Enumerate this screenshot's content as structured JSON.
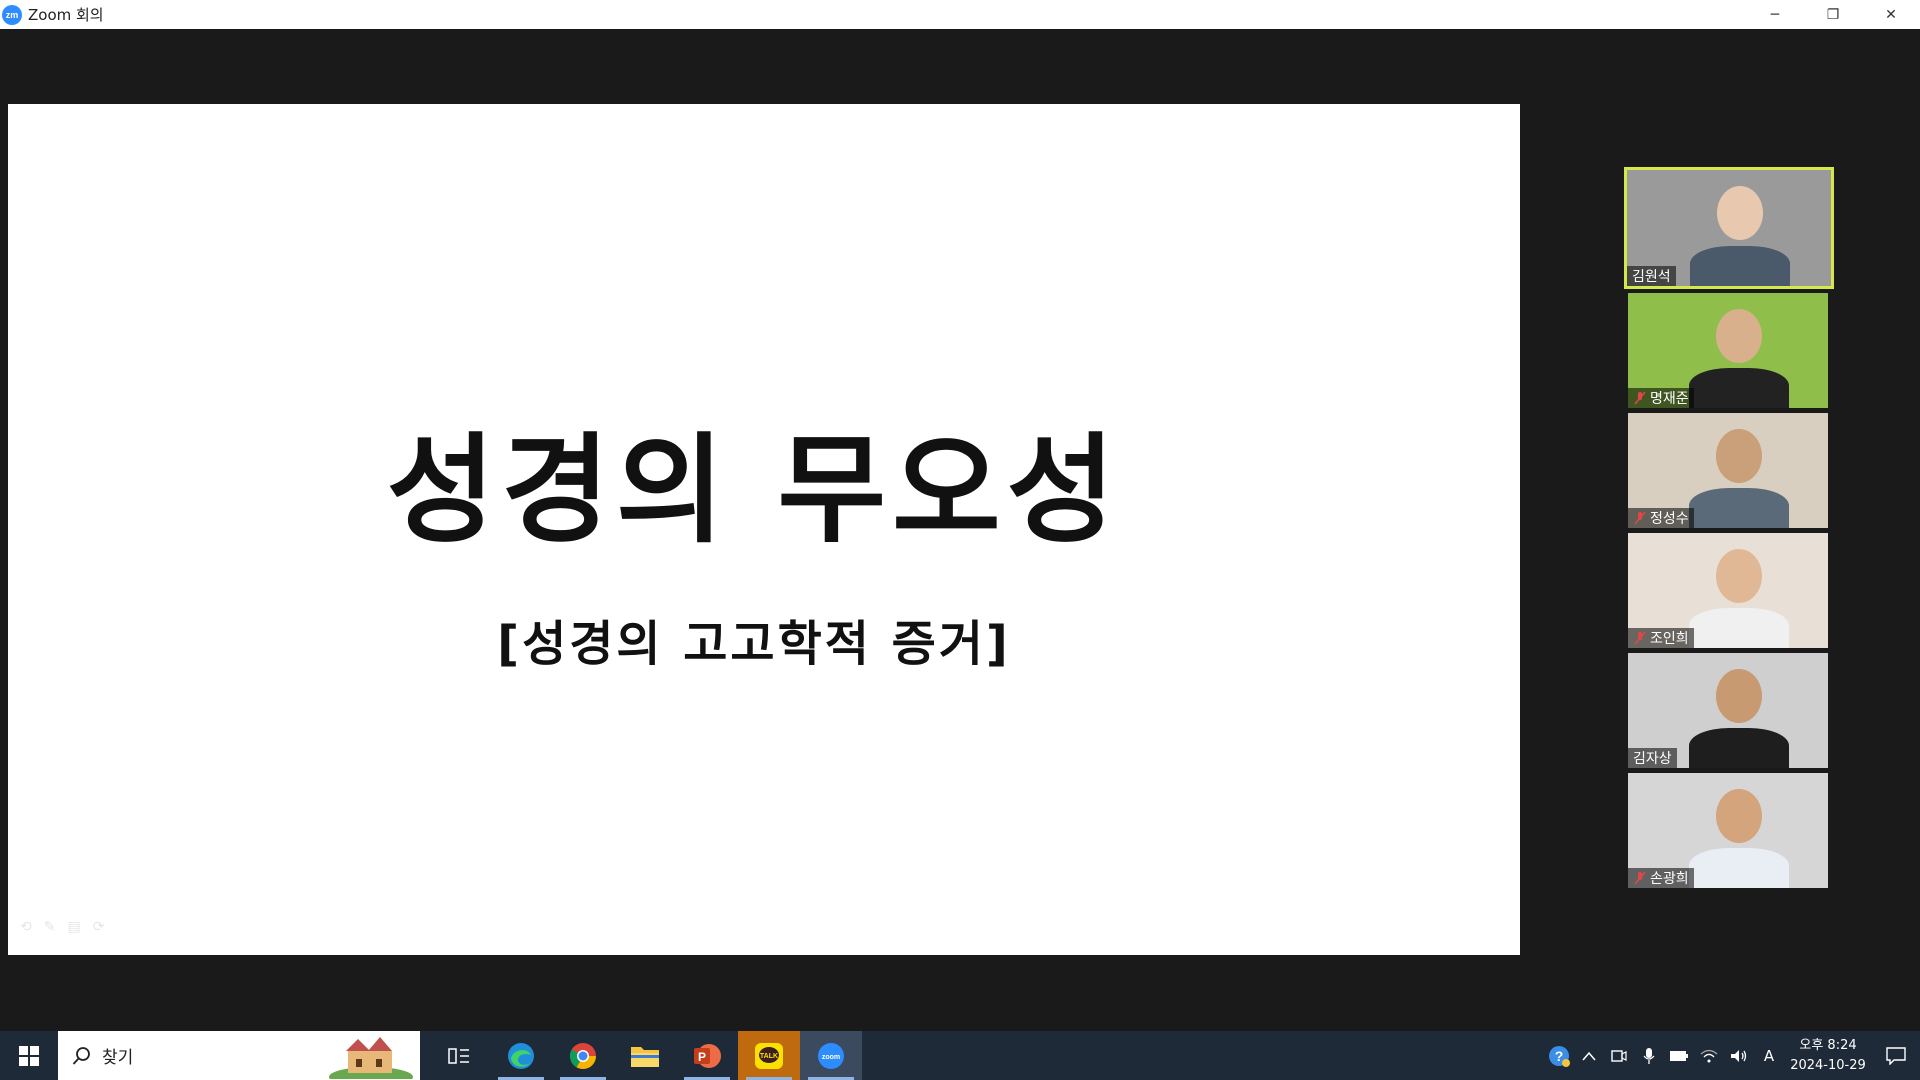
{
  "window": {
    "logo_text": "zm",
    "title": "Zoom 회의",
    "controls": {
      "minimize": "─",
      "restore": "❐",
      "close": "✕"
    }
  },
  "slide": {
    "title": "성경의 무오성",
    "subtitle": "[성경의 고고학적 증거]"
  },
  "participants": [
    {
      "name": "김원석",
      "muted": false,
      "active": true,
      "bg": "#9a9a9a",
      "skin": "#e8c9b0",
      "shirt": "#4a5a6a"
    },
    {
      "name": "명재준",
      "muted": true,
      "active": false,
      "bg": "#8fbf4a",
      "skin": "#d9b08c",
      "shirt": "#222222"
    },
    {
      "name": "정성수",
      "muted": true,
      "active": false,
      "bg": "#d8cfc0",
      "skin": "#c9a07a",
      "shirt": "#5a6a78"
    },
    {
      "name": "조인희",
      "muted": true,
      "active": false,
      "bg": "#e8e0d6",
      "skin": "#e0b896",
      "shirt": "#f0f0f0"
    },
    {
      "name": "김자상",
      "muted": false,
      "active": false,
      "bg": "#cfcfcf",
      "skin": "#c89a72",
      "shirt": "#1e1e1e"
    },
    {
      "name": "손광희",
      "muted": true,
      "active": false,
      "bg": "#d6d6d6",
      "skin": "#d4a47c",
      "shirt": "#e8eef4"
    }
  ],
  "taskbar": {
    "search_placeholder": "찾기",
    "apps": [
      {
        "id": "task-view",
        "label": "Task View"
      },
      {
        "id": "edge",
        "label": "Edge"
      },
      {
        "id": "chrome",
        "label": "Chrome"
      },
      {
        "id": "explorer",
        "label": "File Explorer"
      },
      {
        "id": "powerpoint",
        "label": "PowerPoint"
      },
      {
        "id": "kakaotalk",
        "label": "TALK"
      },
      {
        "id": "zoom",
        "label": "zoom"
      }
    ],
    "tray": {
      "ime": "A",
      "clock_time": "오후 8:24",
      "clock_date": "2024-10-29"
    }
  }
}
